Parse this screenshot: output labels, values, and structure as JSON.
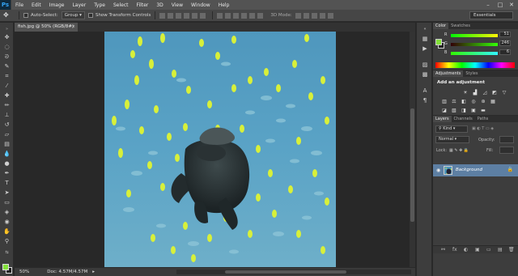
{
  "app": {
    "logo": "Ps"
  },
  "menu": [
    "File",
    "Edit",
    "Image",
    "Layer",
    "Type",
    "Select",
    "Filter",
    "3D",
    "View",
    "Window",
    "Help"
  ],
  "window_controls": {
    "minimize": "–",
    "maximize": "□",
    "close": "✕"
  },
  "options_bar": {
    "auto_select_label": "Auto-Select:",
    "auto_select_value": "Group",
    "transform_label": "Show Transform Controls",
    "mode_3d_label": "3D Mode:",
    "workspace": "Essentials"
  },
  "document": {
    "tab_label": "fish.jpg @ 50% (RGB/8#)",
    "tab_close": "×",
    "zoom": "50%",
    "doc_info": "Doc: 4.57M/4.57M",
    "status_arrow": "▸"
  },
  "tools": {
    "foreground_color": "#83e03a",
    "background_color": "#1e1e1e"
  },
  "color_panel": {
    "tabs": [
      "Color",
      "Swatches"
    ],
    "channels": [
      {
        "label": "R",
        "value": "51"
      },
      {
        "label": "G",
        "value": "246"
      },
      {
        "label": "B",
        "value": "6"
      }
    ]
  },
  "adjustments_panel": {
    "tabs": [
      "Adjustments",
      "Styles"
    ],
    "title": "Add an adjustment"
  },
  "layers_panel": {
    "tabs": [
      "Layers",
      "Channels",
      "Paths"
    ],
    "kind_filter": "Kind",
    "blend_mode": "Normal",
    "opacity_label": "Opacity:",
    "lock_label": "Lock:",
    "fill_label": "Fill:",
    "layer_name": "Background",
    "bottom_icons": [
      "fx",
      "◐",
      "▣",
      "▭",
      "▤",
      "🗑"
    ]
  }
}
